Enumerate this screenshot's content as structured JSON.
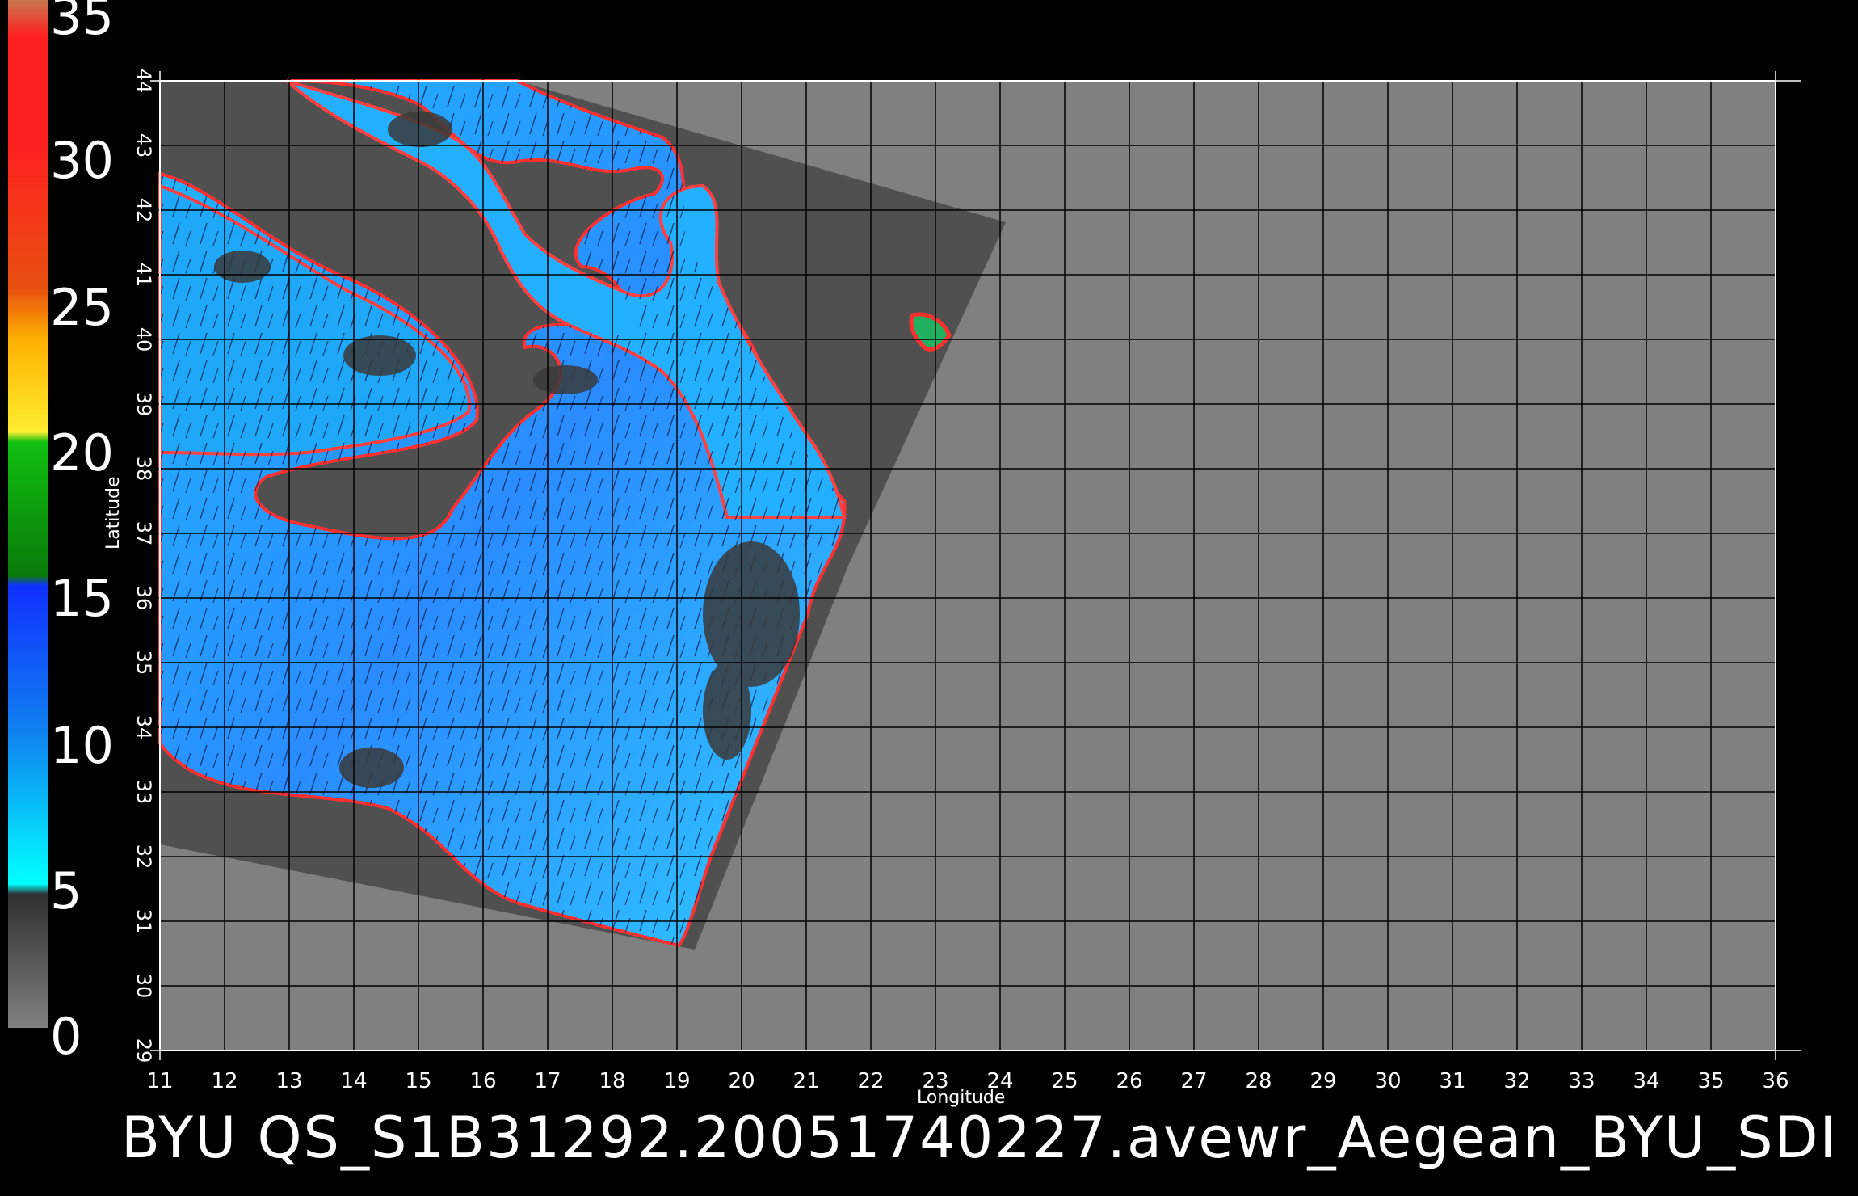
{
  "colorbar": {
    "ticks": [
      "35",
      "30",
      "25",
      "20",
      "15",
      "10",
      "5",
      "0"
    ],
    "colors": [
      "#c87850",
      "#ff2020",
      "#e85010",
      "#ffb000",
      "#ffee30",
      "#10c010",
      "#10a010",
      "#2040ff",
      "#1080f0",
      "#20c0ff",
      "#00ffff",
      "#404040",
      "#808080"
    ]
  },
  "axes": {
    "xlabel": "Longitude",
    "ylabel": "Latitude",
    "x_ticks": [
      "11",
      "12",
      "13",
      "14",
      "15",
      "16",
      "17",
      "18",
      "19",
      "20",
      "21",
      "22",
      "23",
      "24",
      "25",
      "26",
      "27",
      "28",
      "29",
      "30",
      "31",
      "32",
      "33",
      "34",
      "35",
      "36"
    ],
    "y_ticks": [
      "29",
      "30",
      "31",
      "32",
      "33",
      "34",
      "35",
      "36",
      "37",
      "38",
      "39",
      "40",
      "41",
      "42",
      "43",
      "44"
    ]
  },
  "map": {
    "region": "Aegean",
    "land_color": "#505050",
    "nodata_color": "#808080",
    "ocean_color": "#30a8ff",
    "grid_color": "#000000"
  },
  "caption": "BYU  QS_S1B31292.20051740227.avewr_Aegean_BYU_SDI"
}
